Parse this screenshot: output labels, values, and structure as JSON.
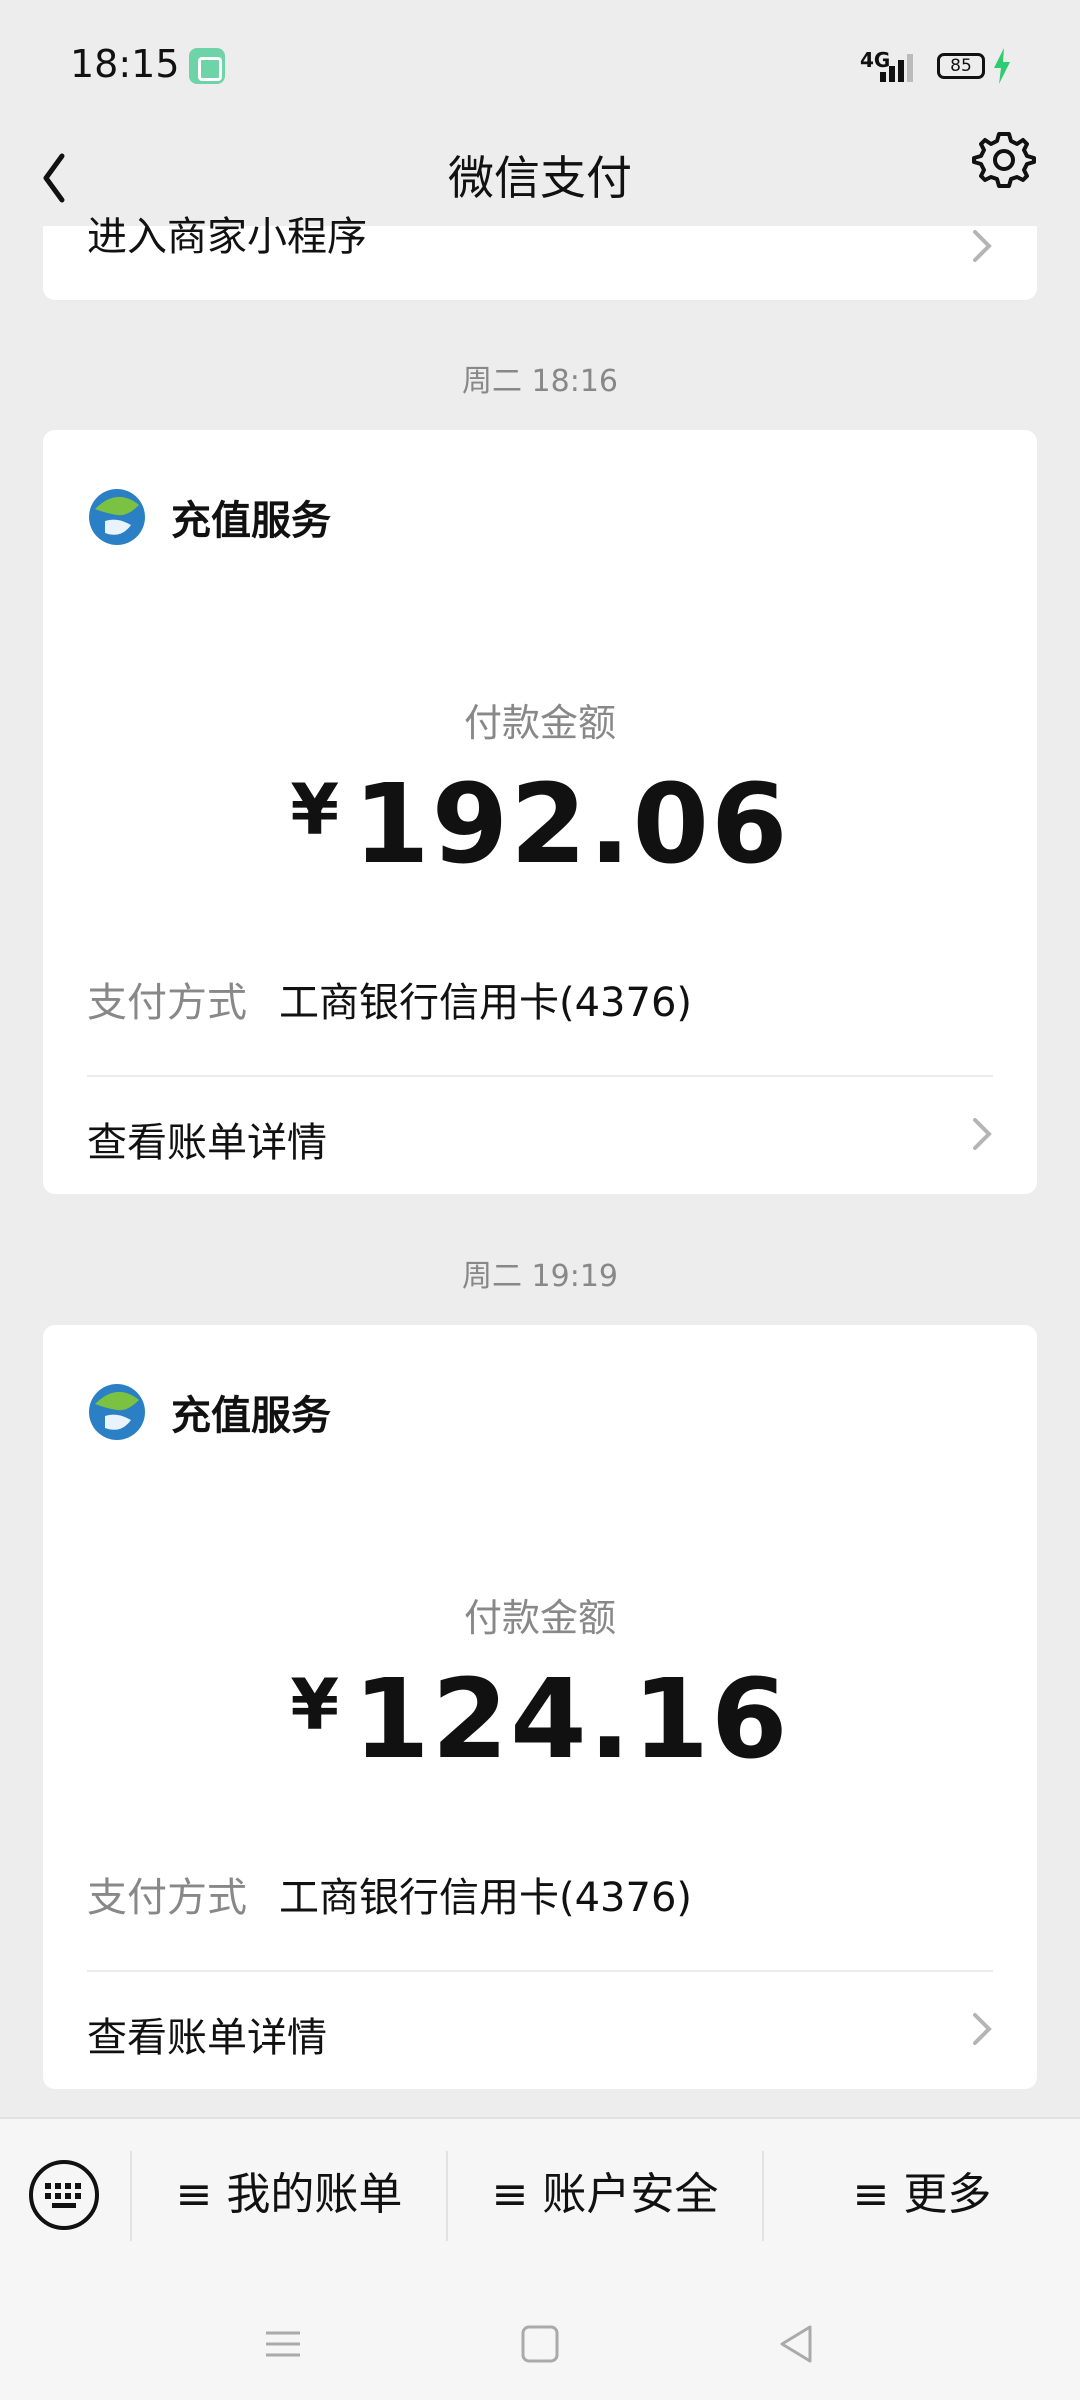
{
  "status_bar": {
    "time": "18:15",
    "network": "4G",
    "battery": "85"
  },
  "nav": {
    "title": "微信支付"
  },
  "top_card": {
    "link_label": "进入商家小程序"
  },
  "messages": [
    {
      "timestamp": "周二 18:16",
      "merchant": "充值服务",
      "amount_label": "付款金额",
      "currency": "¥",
      "amount": "192.06",
      "pay_method_label": "支付方式",
      "pay_method_value": "工商银行信用卡(4376)",
      "details_label": "查看账单详情"
    },
    {
      "timestamp": "周二 19:19",
      "merchant": "充值服务",
      "amount_label": "付款金额",
      "currency": "¥",
      "amount": "124.16",
      "pay_method_label": "支付方式",
      "pay_method_value": "工商银行信用卡(4376)",
      "details_label": "查看账单详情"
    }
  ],
  "bottom_menu": {
    "items": [
      {
        "label": "≡ 我的账单"
      },
      {
        "label": "≡ 账户安全"
      },
      {
        "label": "≡ 更多"
      }
    ]
  },
  "colors": {
    "background": "#ededed",
    "card": "#ffffff",
    "accent_charge": "#2ecc71"
  },
  "icons": [
    "back-icon",
    "gear-icon",
    "chevron-right-icon",
    "merchant-logo-icon",
    "keyboard-icon",
    "menu-icon",
    "home-icon",
    "back-triangle-icon"
  ]
}
